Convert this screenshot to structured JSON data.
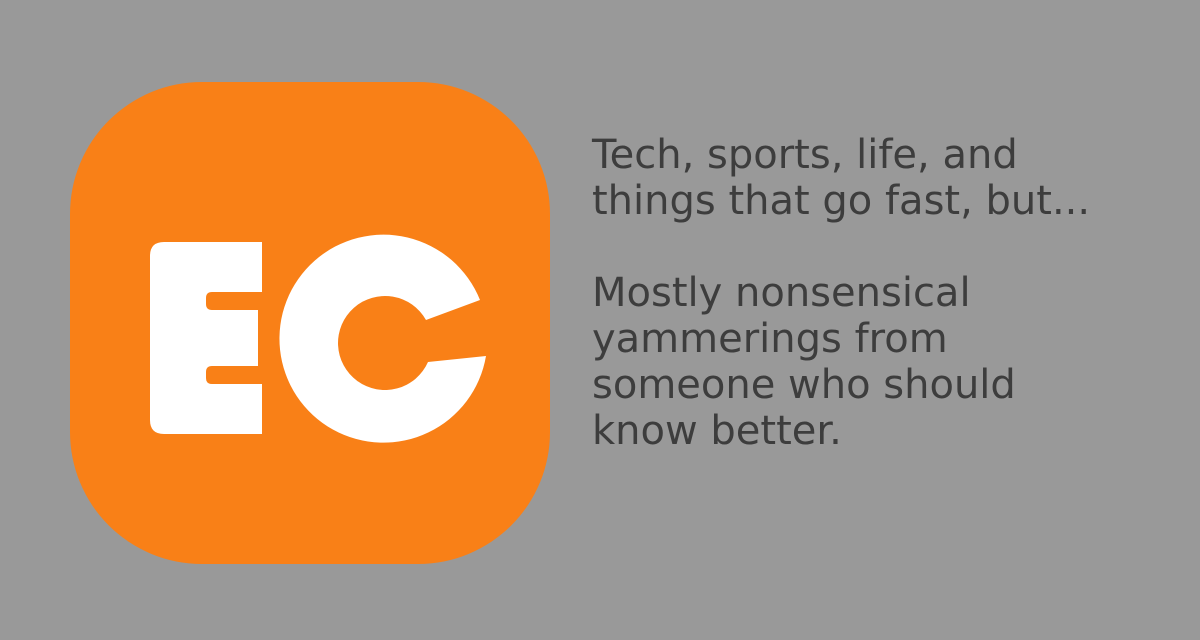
{
  "logo": {
    "text": "EC",
    "background_color": "#F98017",
    "letter_color": "#FFFFFF"
  },
  "tagline": {
    "line1": "Tech, sports, life, and\nthings that go fast, but...",
    "line2": "Mostly nonsensical\nyammerings from\nsomeone who should\nknow better."
  },
  "page": {
    "background_color": "#999999",
    "text_color": "#3D3D3D"
  }
}
